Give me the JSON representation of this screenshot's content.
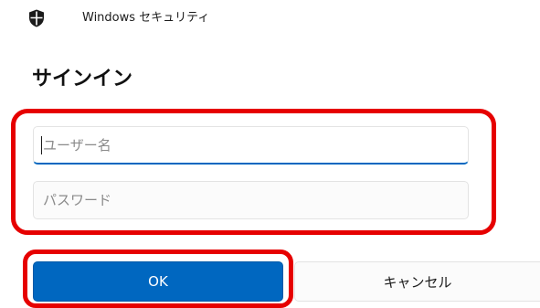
{
  "window": {
    "icon": "shield-icon",
    "title": "Windows セキュリティ"
  },
  "dialog": {
    "heading": "サインイン"
  },
  "form": {
    "username_placeholder": "ユーザー名",
    "password_placeholder": "パスワード"
  },
  "buttons": {
    "ok_label": "OK",
    "cancel_label": "キャンセル"
  },
  "colors": {
    "accent": "#0067c0",
    "highlight": "#e60000"
  }
}
